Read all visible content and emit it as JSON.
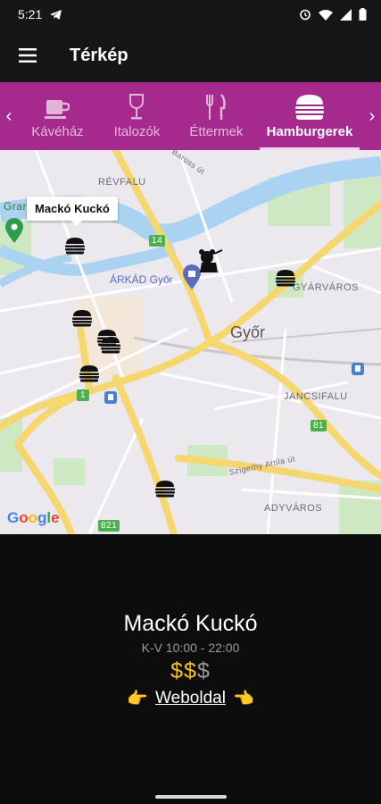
{
  "status_bar": {
    "time": "5:21"
  },
  "app_bar": {
    "title": "Térkép"
  },
  "tabs": [
    {
      "label": "Kávéház",
      "icon": "coffee-cup-icon"
    },
    {
      "label": "Italozók",
      "icon": "wine-glass-icon"
    },
    {
      "label": "Éttermek",
      "icon": "fork-knife-icon"
    },
    {
      "label": "Hamburgerek",
      "icon": "burger-icon",
      "active": true
    }
  ],
  "map": {
    "labels": {
      "revfalu": "RÉVFALU",
      "arkad": "ÁRKÁD Győr",
      "gyor": "Győr",
      "gyarvaros": "GYÁRVÁROS",
      "jancsifalu": "JANCSIFALU",
      "adyvaros": "ADYVÁROS",
      "road14": "14",
      "road81": "81",
      "road821": "821",
      "road1": "1",
      "baross": "Baross út",
      "szigethy": "Szigethy Attila út",
      "grand": "Grand"
    },
    "callout": "Mackó Kuckó",
    "markers": 7,
    "google": "Google"
  },
  "detail": {
    "name": "Mackó Kuckó",
    "hours": "K-V 10:00 - 22:00",
    "price_level": 2,
    "price_max": 3,
    "price_symbol": "$",
    "website": "Weboldal",
    "hand_left": "👉",
    "hand_right": "👈"
  },
  "colors": {
    "accent": "#a6298d",
    "price": "#f5c518",
    "road": "#f6d66e",
    "water": "#aad3f2",
    "park": "#cfe8c4"
  }
}
